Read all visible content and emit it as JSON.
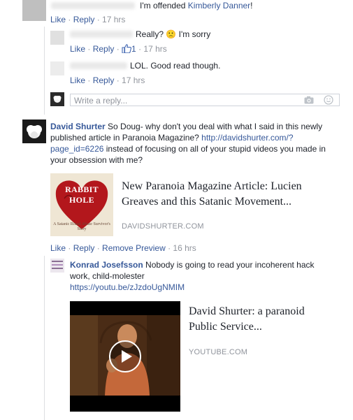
{
  "comments": {
    "c1": {
      "text_pre": "I'm offended ",
      "mention": "Kimberly Danner",
      "text_post": "!",
      "like": "Like",
      "reply": "Reply",
      "time": "17 hrs"
    },
    "c2": {
      "text": "Really? ",
      "emoji": "🙁",
      "text_post": " I'm sorry",
      "like": "Like",
      "reply": "Reply",
      "likes": "1",
      "time": "17 hrs"
    },
    "c3": {
      "text": "LOL. Good read though.",
      "like": "Like",
      "reply": "Reply",
      "time": "17 hrs"
    },
    "reply_box": {
      "placeholder": "Write a reply..."
    },
    "david": {
      "name": "David Shurter",
      "text1": "So Doug- why don't you deal with what I said in this newly published article in Paranoia Magazine?",
      "url": "http://davidshurter.com/?page_id=6226",
      "text2": "instead of focusing on all of your stupid videos you made in your obsession with me?",
      "preview_title": "New Paranoia Magazine Article: Lucien Greaves and this Satanic Movement...",
      "preview_domain": "DAVIDSHURTER.COM",
      "thumb_title": "RABBIT HOLE",
      "thumb_sub": "A Satanic Ritual Abuse Survivor's Story",
      "like": "Like",
      "reply": "Reply",
      "remove_preview": "Remove Preview",
      "time": "16 hrs"
    },
    "konrad": {
      "name": "Konrad Josefsson",
      "text": "Nobody is going to read your incoherent hack work, child-molester",
      "url": "https://youtu.be/zJzdoUgNMIM",
      "preview_title": "David Shurter: a paranoid Public Service...",
      "preview_domain": "YOUTUBE.COM"
    }
  },
  "colors": {
    "link": "#365899",
    "meta_gray": "#90949c",
    "border": "#dddfe2"
  },
  "icons": [
    "camera-icon",
    "smiley-icon",
    "thumbs-up-icon",
    "play-icon"
  ]
}
